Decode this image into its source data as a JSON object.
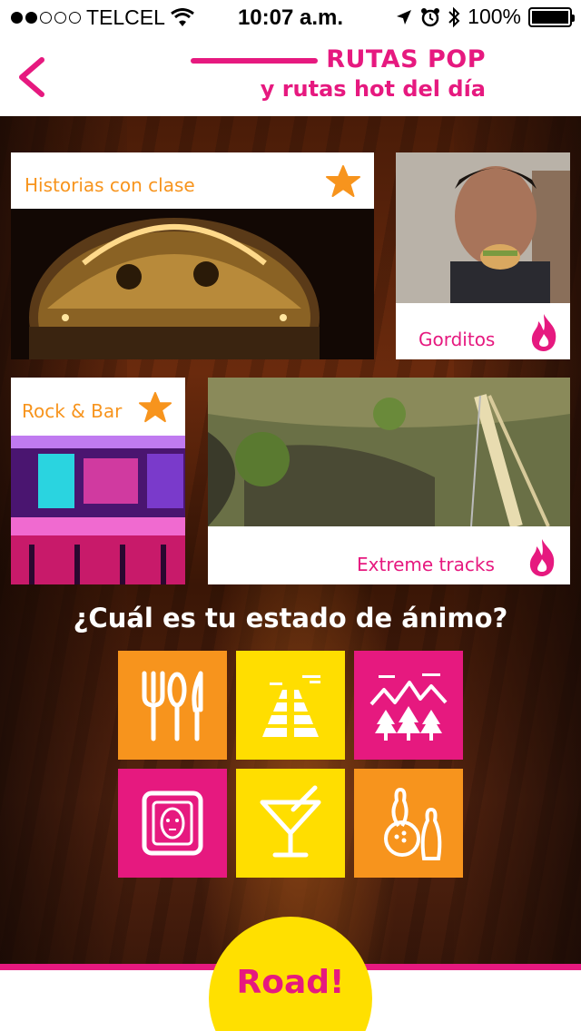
{
  "status_bar": {
    "carrier": "TELCEL",
    "time": "10:07 a.m.",
    "battery": "100%"
  },
  "header": {
    "title": "RUTAS POP",
    "subtitle": "y rutas hot del día"
  },
  "cards": {
    "historias": {
      "label": "Historias con clase",
      "badge": "star-icon"
    },
    "gorditos": {
      "label": "Gorditos",
      "badge": "flame-icon"
    },
    "rock": {
      "label": "Rock & Bar",
      "badge": "star-icon"
    },
    "extreme": {
      "label": "Extreme tracks",
      "badge": "flame-icon"
    }
  },
  "mood": {
    "question": "¿Cuál es tu estado de ánimo?",
    "tiles": [
      {
        "icon": "cutlery-icon",
        "color": "#f7941d"
      },
      {
        "icon": "pyramid-icon",
        "color": "#ffde00"
      },
      {
        "icon": "mountains-trees-icon",
        "color": "#e6197f"
      },
      {
        "icon": "framed-art-icon",
        "color": "#e6197f"
      },
      {
        "icon": "cocktail-icon",
        "color": "#ffde00"
      },
      {
        "icon": "bowling-icon",
        "color": "#f7941d"
      }
    ]
  },
  "road_button": {
    "label": "Road!"
  },
  "colors": {
    "pink": "#e6197f",
    "orange": "#f7941d",
    "yellow": "#ffde00"
  }
}
